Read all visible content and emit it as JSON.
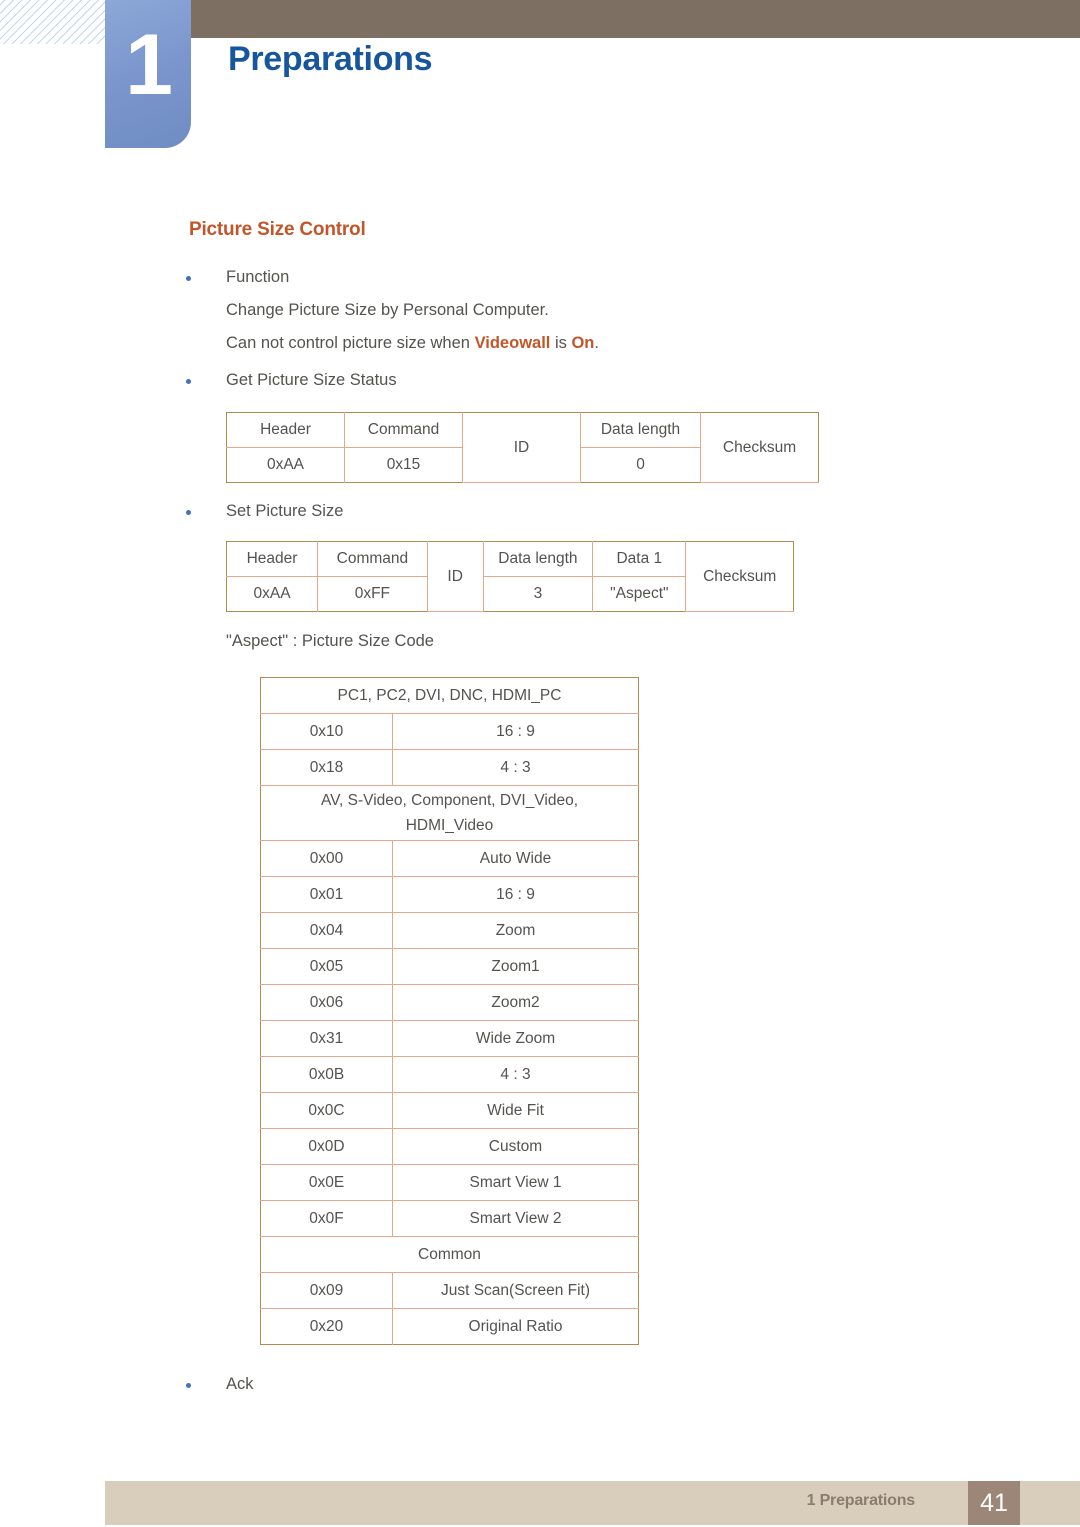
{
  "header": {
    "chapter_number": "1",
    "chapter_title": "Preparations"
  },
  "section": {
    "heading": "Picture Size Control"
  },
  "bullets": {
    "function": "Function",
    "function_line1": "Change Picture Size by Personal Computer.",
    "function_line2_pre": "Can not control picture size when ",
    "function_line2_hl1": "Videowall",
    "function_line2_mid": " is ",
    "function_line2_hl2": "On",
    "function_line2_post": ".",
    "get_status": "Get Picture Size Status",
    "set_size": "Set Picture Size",
    "aspect_caption": "\"Aspect\" : Picture Size Code",
    "ack": "Ack"
  },
  "table_get": {
    "headers": [
      "Header",
      "Command",
      "ID",
      "Data length",
      "Checksum"
    ],
    "values": [
      "0xAA",
      "0x15",
      "0"
    ]
  },
  "table_set": {
    "headers": [
      "Header",
      "Command",
      "ID",
      "Data length",
      "Data 1",
      "Checksum"
    ],
    "values": [
      "0xAA",
      "0xFF",
      "3",
      "\"Aspect\""
    ]
  },
  "table_code": {
    "group1_title": "PC1, PC2, DVI, DNC, HDMI_PC",
    "group1_rows": [
      {
        "code": "0x10",
        "name": "16 : 9"
      },
      {
        "code": "0x18",
        "name": "4 : 3"
      }
    ],
    "group2_title_line1": "AV, S-Video, Component, DVI_Video,",
    "group2_title_line2": "HDMI_Video",
    "group2_rows": [
      {
        "code": "0x00",
        "name": "Auto Wide"
      },
      {
        "code": "0x01",
        "name": "16 : 9"
      },
      {
        "code": "0x04",
        "name": "Zoom"
      },
      {
        "code": "0x05",
        "name": "Zoom1"
      },
      {
        "code": "0x06",
        "name": "Zoom2"
      },
      {
        "code": "0x31",
        "name": "Wide Zoom"
      },
      {
        "code": "0x0B",
        "name": "4 : 3"
      },
      {
        "code": "0x0C",
        "name": "Wide Fit"
      },
      {
        "code": "0x0D",
        "name": "Custom"
      },
      {
        "code": "0x0E",
        "name": "Smart View 1"
      },
      {
        "code": "0x0F",
        "name": "Smart View 2"
      }
    ],
    "group3_title": "Common",
    "group3_rows": [
      {
        "code": "0x09",
        "name": "Just Scan(Screen Fit)"
      },
      {
        "code": "0x20",
        "name": "Original Ratio"
      }
    ]
  },
  "footer": {
    "label": "1 Preparations",
    "page": "41"
  },
  "colors": {
    "accent_orange": "#c2562b",
    "chapter_blue": "#17569c",
    "header_brown": "#7d7062",
    "tab_blue": "#7b96cc",
    "footer_tan": "#d9cdbc",
    "footer_page_brown": "#9b8678",
    "table_border": "#e2a98d",
    "table_outer_border": "#b08a4f"
  }
}
